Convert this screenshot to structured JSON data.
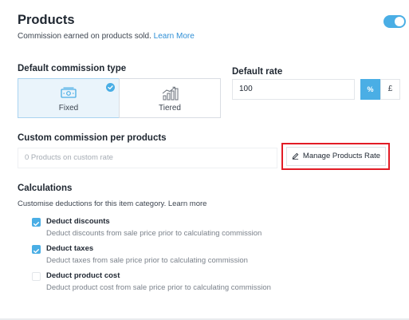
{
  "header": {
    "title": "Products",
    "subtitle": "Commission earned on products sold.",
    "learn_more": "Learn More",
    "toggle_on": true
  },
  "commission_type": {
    "label": "Default commission type",
    "options": [
      {
        "label": "Fixed",
        "selected": true,
        "icon": "banknote-icon"
      },
      {
        "label": "Tiered",
        "selected": false,
        "icon": "bar-chart-growth-icon"
      }
    ]
  },
  "default_rate": {
    "label": "Default rate",
    "value": "100",
    "units": [
      {
        "label": "%",
        "selected": true
      },
      {
        "label": "£",
        "selected": false
      }
    ]
  },
  "custom_commission": {
    "label": "Custom commission per products",
    "placeholder": "0 Products on custom rate",
    "button_label": "Manage Products Rate",
    "button_icon": "pencil-icon"
  },
  "calculations": {
    "title": "Calculations",
    "subtitle": "Customise deductions for this item category. Learn more",
    "items": [
      {
        "label": "Deduct discounts",
        "desc": "Deduct discounts from sale price prior to calculating commission",
        "checked": true
      },
      {
        "label": "Deduct taxes",
        "desc": "Deduct taxes from sale price prior to calculating commission",
        "checked": true
      },
      {
        "label": "Deduct product cost",
        "desc": "Deduct product cost from sale price prior to calculating commission",
        "checked": false
      }
    ]
  },
  "colors": {
    "accent": "#4aaee5",
    "highlight": "#e21c26",
    "link": "#2f8fd6"
  }
}
